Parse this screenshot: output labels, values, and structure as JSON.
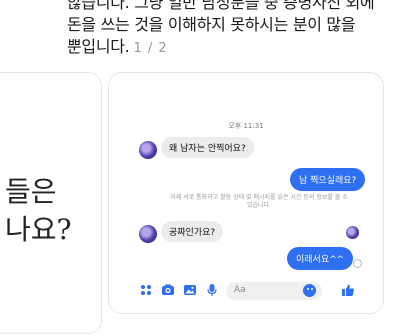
{
  "caption": {
    "lines": [
      "않습니다. 그냥 일반 남성분들 중 증명사진 외에",
      "돈을 쓰는 것을 이해하지 못하시는 분이 많을",
      "뿐입니다."
    ],
    "page_indicator": "1 / 2"
  },
  "left_card": {
    "line1": "들은",
    "line2": "나요?"
  },
  "chat": {
    "timestamp": "오후 11:31",
    "messages": [
      {
        "side": "in",
        "text": "왜 남자는 안찍어요?"
      },
      {
        "side": "out",
        "text": "남 찍으실래요?"
      },
      {
        "side": "in",
        "text": "공짜인가요?"
      },
      {
        "side": "out",
        "text": "이래서요^^"
      }
    ],
    "notice": "이제 서로 통화하고 활동 상태 및 메시지를 읽은 시간 등의 정보를 볼 수 있습니다."
  },
  "composer": {
    "placeholder": "Aa",
    "icons": [
      "apps-icon",
      "camera-icon",
      "image-icon",
      "mic-icon",
      "emoji-icon",
      "like-icon"
    ]
  },
  "colors": {
    "accent": "#2f6ff2",
    "bubble_in": "#ececec"
  }
}
